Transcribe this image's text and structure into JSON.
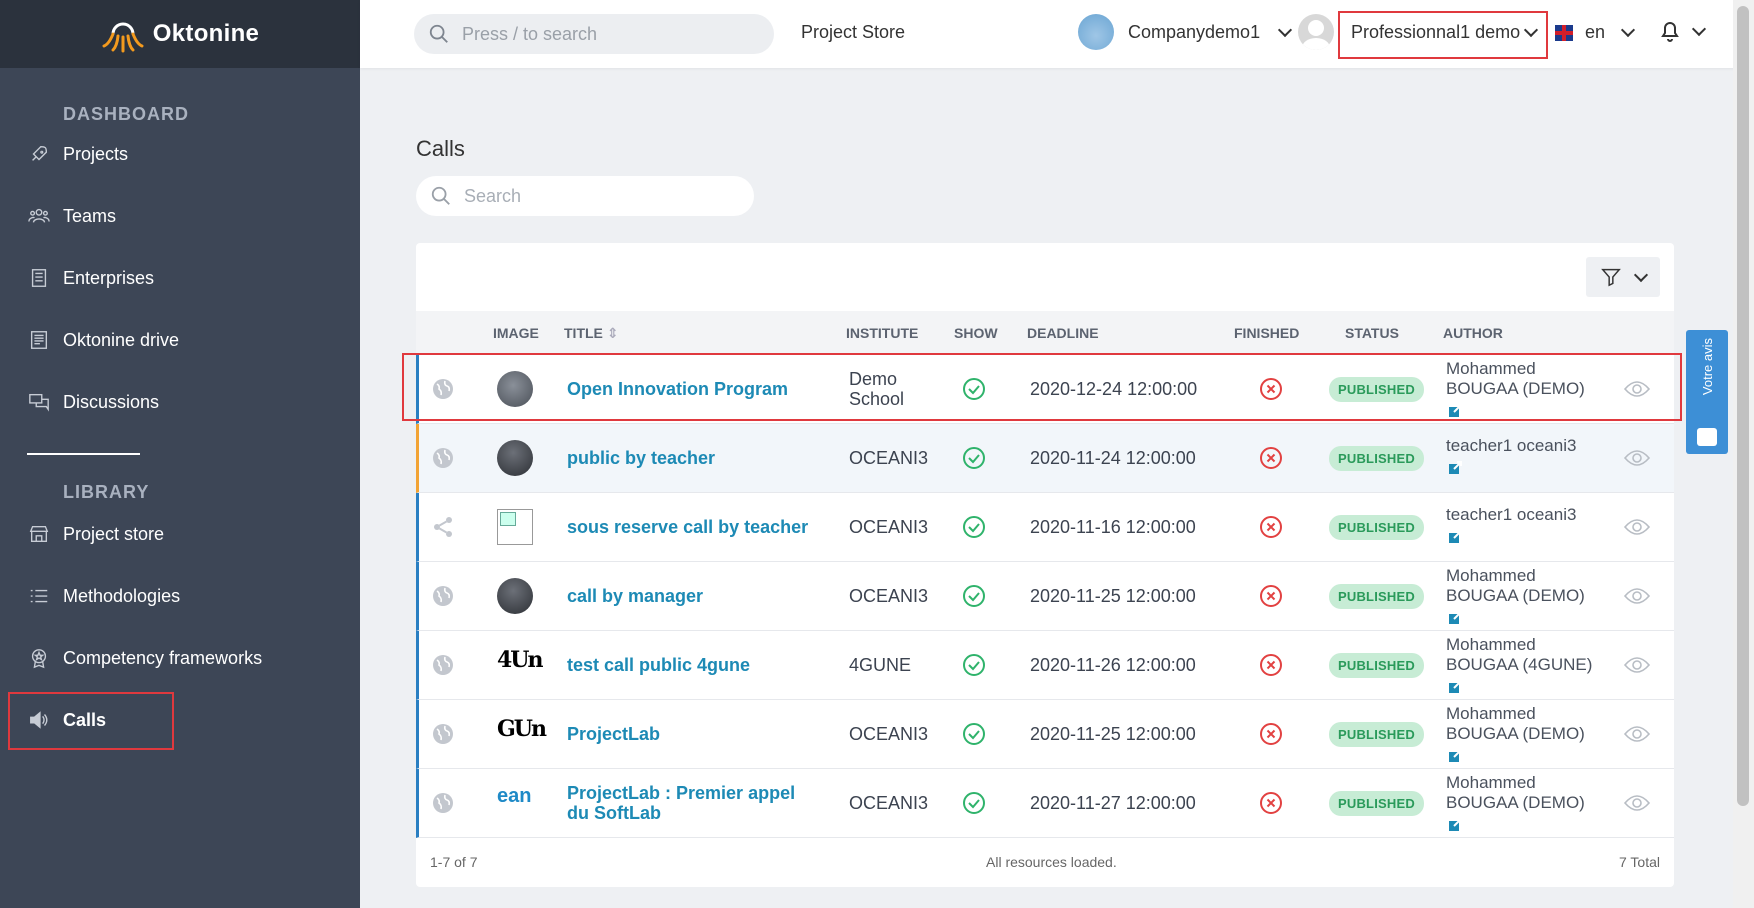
{
  "brand": {
    "name": "Oktonine"
  },
  "sidebar": {
    "sections": {
      "dashboard": "DASHBOARD",
      "library": "LIBRARY"
    },
    "dashboard_items": [
      {
        "label": "Projects",
        "icon": "rocket-icon"
      },
      {
        "label": "Teams",
        "icon": "people-icon"
      },
      {
        "label": "Enterprises",
        "icon": "building-icon"
      },
      {
        "label": "Oktonine drive",
        "icon": "document-icon"
      },
      {
        "label": "Discussions",
        "icon": "chat-icon"
      }
    ],
    "library_items": [
      {
        "label": "Project store",
        "icon": "store-icon"
      },
      {
        "label": "Methodologies",
        "icon": "list-icon"
      },
      {
        "label": "Competency frameworks",
        "icon": "badge-icon"
      },
      {
        "label": "Calls",
        "icon": "megaphone-icon"
      }
    ]
  },
  "topbar": {
    "search_placeholder": "Press / to search",
    "project_store": "Project Store",
    "company": "Companydemo1",
    "user": "Professionnal1 demo",
    "language": "en"
  },
  "main": {
    "title": "Calls",
    "search_placeholder": "Search",
    "columns": [
      "IMAGE",
      "TITLE",
      "INSTITUTE",
      "SHOW",
      "DEADLINE",
      "FINISHED",
      "STATUS",
      "AUTHOR"
    ],
    "rows": [
      {
        "visibility": "public",
        "image": "photo",
        "title": "Open Innovation Program",
        "institute": "Demo School",
        "show": true,
        "deadline": "2020-12-24 12:00:00",
        "finished": false,
        "status": "PUBLISHED",
        "author": "Mohammed BOUGAA (DEMO)"
      },
      {
        "visibility": "public",
        "image": "photo-dark",
        "title": "public by teacher",
        "institute": "OCEANI3",
        "show": true,
        "deadline": "2020-11-24 12:00:00",
        "finished": false,
        "status": "PUBLISHED",
        "author": "teacher1 oceani3"
      },
      {
        "visibility": "shared",
        "image": "broken",
        "title": "sous reserve call by teacher",
        "institute": "OCEANI3",
        "show": true,
        "deadline": "2020-11-16 12:00:00",
        "finished": false,
        "status": "PUBLISHED",
        "author": "teacher1 oceani3"
      },
      {
        "visibility": "public",
        "image": "photo-dark",
        "title": "call by manager",
        "institute": "OCEANI3",
        "show": true,
        "deadline": "2020-11-25 12:00:00",
        "finished": false,
        "status": "PUBLISHED",
        "author": "Mohammed BOUGAA (DEMO)"
      },
      {
        "visibility": "public",
        "image": "logo-4gune",
        "title": "test call public 4gune",
        "institute": "4GUNE",
        "show": true,
        "deadline": "2020-11-26 12:00:00",
        "finished": false,
        "status": "PUBLISHED",
        "author": "Mohammed BOUGAA (4GUNE)"
      },
      {
        "visibility": "public",
        "image": "logo-gun",
        "title": "ProjectLab",
        "institute": "OCEANI3",
        "show": true,
        "deadline": "2020-11-25 12:00:00",
        "finished": false,
        "status": "PUBLISHED",
        "author": "Mohammed BOUGAA (DEMO)"
      },
      {
        "visibility": "public",
        "image": "logo-ean",
        "title": "ProjectLab : Premier appel du SoftLab",
        "institute": "OCEANI3",
        "show": true,
        "deadline": "2020-11-27 12:00:00",
        "finished": false,
        "status": "PUBLISHED",
        "author": "Mohammed BOUGAA (DEMO)"
      }
    ],
    "footer": {
      "range": "1-7 of 7",
      "loaded": "All resources loaded.",
      "total": "7 Total"
    },
    "logo_texts": {
      "gune4": "4Un",
      "gun": "GUn",
      "ean": "ean"
    }
  },
  "feedback": {
    "label": "Votre avis"
  },
  "colors": {
    "sidebar": "#3d4656",
    "link": "#1d8ab5",
    "published_bg": "#c7ecd5",
    "highlight": "#e0393e"
  }
}
